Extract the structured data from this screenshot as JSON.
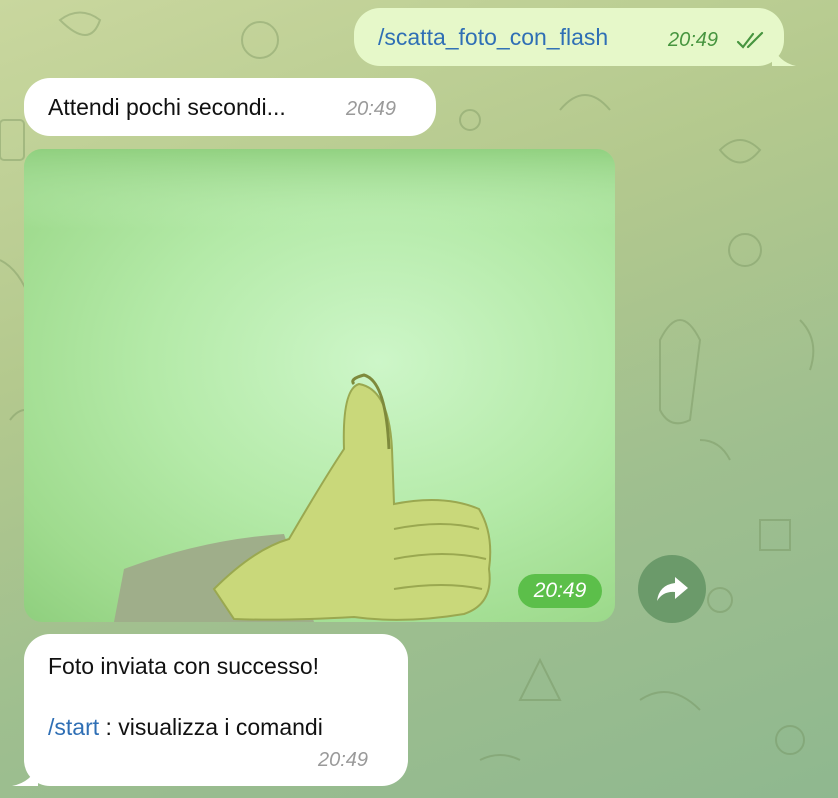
{
  "messages": {
    "outgoing": {
      "text": "/scatta_foto_con_flash",
      "time": "20:49",
      "status_icon": "double-check-icon"
    },
    "incoming_wait": {
      "text": "Attendi pochi secondi...",
      "time": "20:49"
    },
    "incoming_photo": {
      "time": "20:49",
      "forward_icon": "share-arrow-icon"
    },
    "incoming_done": {
      "line1": "Foto inviata con successo!",
      "link": "/start",
      "line2_rest": " : visualizza i comandi",
      "time": "20:49"
    }
  },
  "colors": {
    "outgoing_bubble": "#e6f8c9",
    "incoming_bubble": "#ffffff",
    "link": "#2f6fb5",
    "time_badge": "#5cbf4a"
  }
}
